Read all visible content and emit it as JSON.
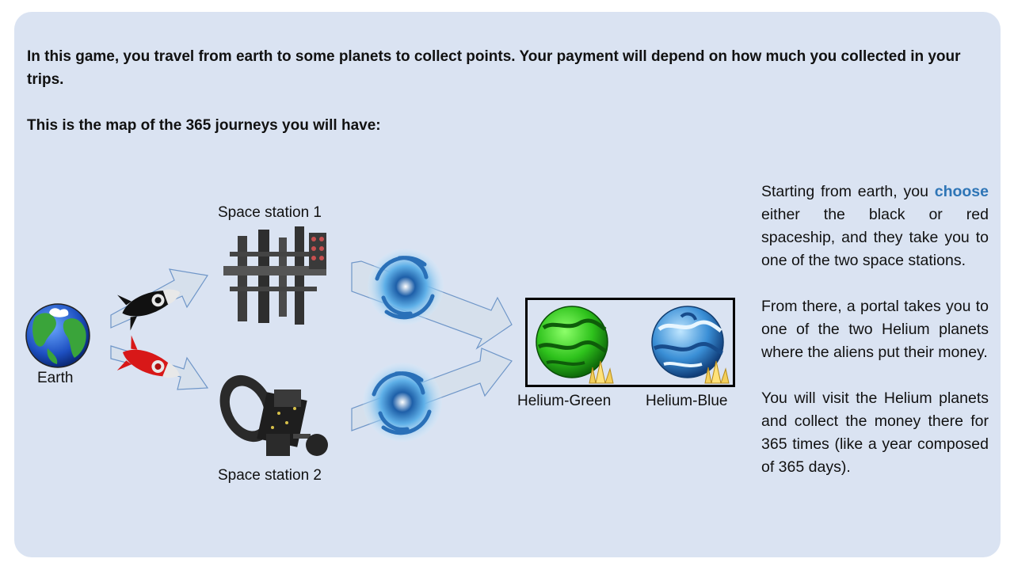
{
  "intro": {
    "line1": "In this game, you travel from earth to some planets to collect points. Your payment will depend on how much you collected in your trips.",
    "line2": "This is the map of the 365 journeys you will have:"
  },
  "map": {
    "earth_label": "Earth",
    "station1_label": "Space station 1",
    "station2_label": "Space station 2",
    "planet_green_label": "Helium-Green",
    "planet_blue_label": "Helium-Blue"
  },
  "instructions": {
    "p1_pre": "Starting from earth, you ",
    "p1_highlight": "choose",
    "p1_post": " either the black or red spaceship, and they take you to one of the two space stations.",
    "p2": "From there, a portal takes you to one of the two Helium planets where the aliens put their money.",
    "p3": "You will visit the Helium planets and collect the money there for 365 times (like a year composed of 365 days)."
  },
  "colors": {
    "panel_bg": "#dae3f2",
    "highlight": "#2e75b6",
    "arrow_fill": "#d6e0ec",
    "arrow_stroke": "#6f96c8"
  },
  "icons": [
    "earth-icon",
    "black-rocket-icon",
    "red-rocket-icon",
    "space-station-1-icon",
    "space-station-2-icon",
    "portal-icon",
    "helium-green-planet-icon",
    "helium-blue-planet-icon",
    "crystal-icon"
  ]
}
